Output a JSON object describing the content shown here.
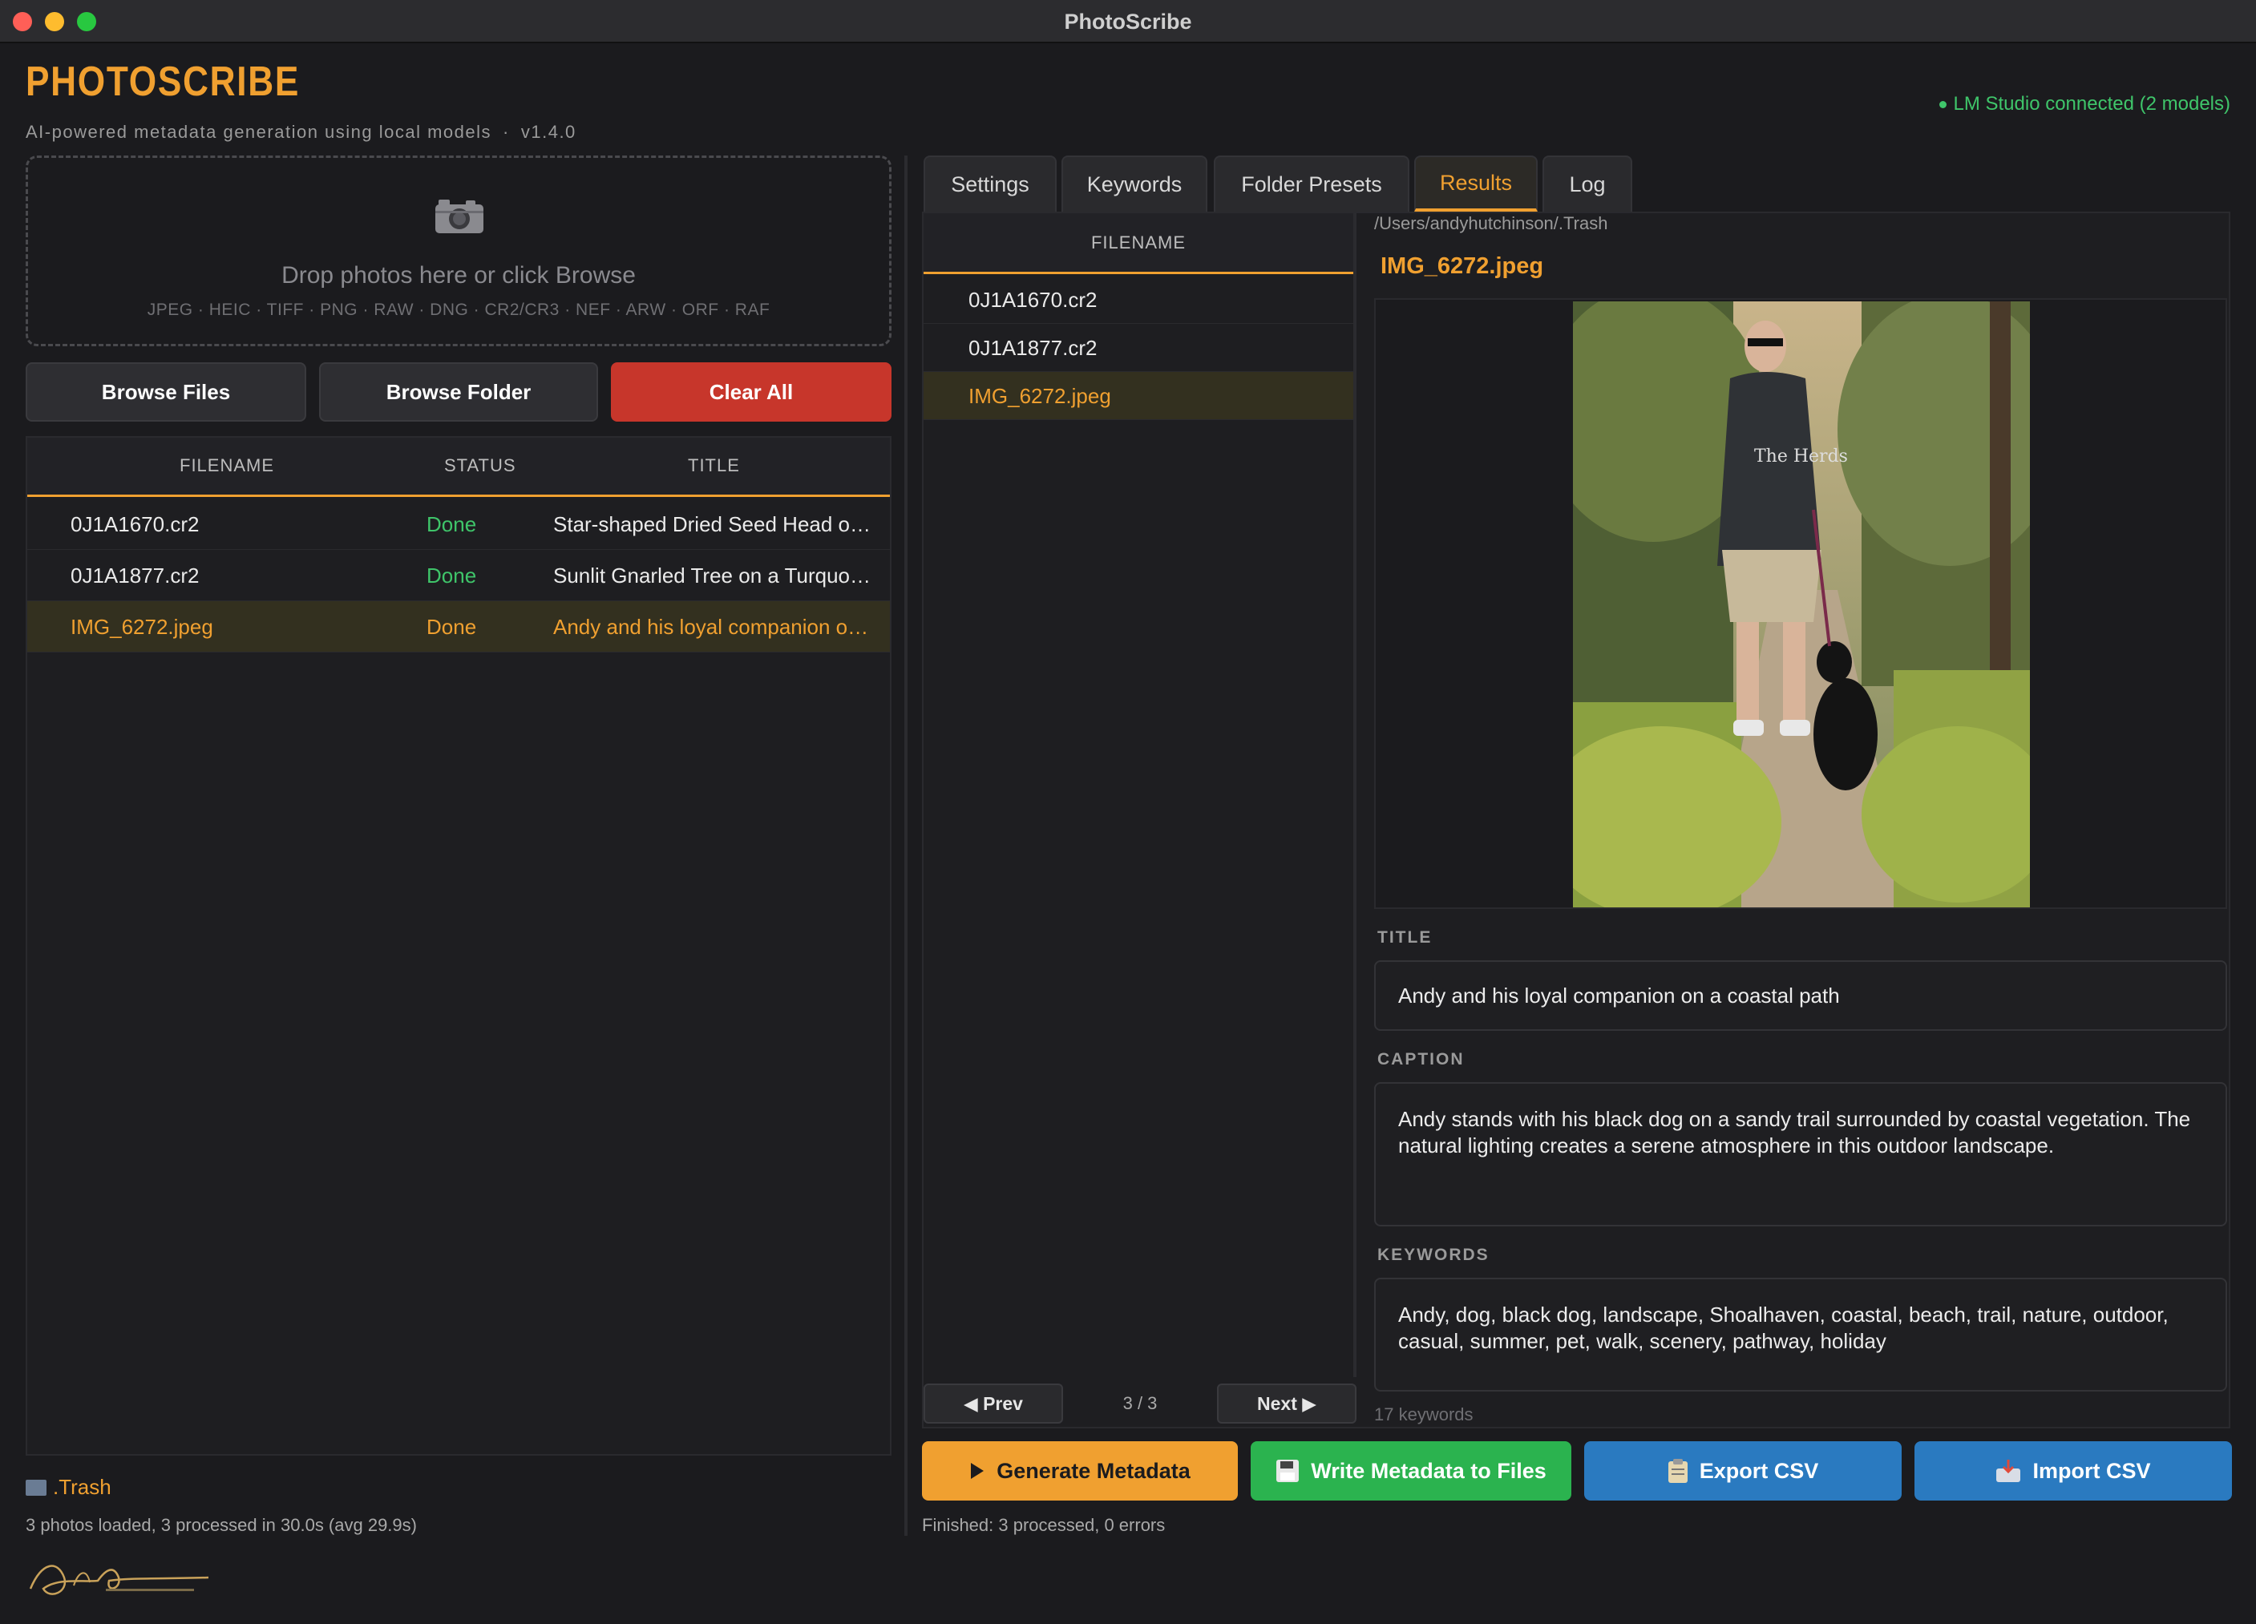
{
  "window": {
    "title": "PhotoScribe"
  },
  "app": {
    "brand": "PHOTOSCRIBE",
    "tagline": "AI-powered metadata generation using local models",
    "version": "v1.4.0",
    "lm_status": "LM Studio connected (2 models)"
  },
  "dropzone": {
    "text": "Drop photos here or click Browse",
    "formats": "JPEG · HEIC · TIFF · PNG · RAW · DNG · CR2/CR3 · NEF · ARW · ORF · RAF"
  },
  "buttons": {
    "browse_files": "Browse Files",
    "browse_folder": "Browse Folder",
    "clear_all": "Clear All"
  },
  "file_table": {
    "columns": [
      "FILENAME",
      "STATUS",
      "TITLE"
    ],
    "rows": [
      {
        "filename": "0J1A1670.cr2",
        "status": "Done",
        "title": "Star-shaped Dried Seed Head on a Turquoise Background"
      },
      {
        "filename": "0J1A1877.cr2",
        "status": "Done",
        "title": "Sunlit Gnarled Tree on a Turquoise Background"
      },
      {
        "filename": "IMG_6272.jpeg",
        "status": "Done",
        "title": "Andy and his loyal companion on a coastal path"
      }
    ]
  },
  "folder": {
    "name": ".Trash"
  },
  "left_status": "3 photos loaded, 3 processed in 30.0s (avg 29.9s)",
  "tabs": [
    "Settings",
    "Keywords",
    "Folder Presets",
    "Results",
    "Log"
  ],
  "results": {
    "list_header": "FILENAME",
    "files": [
      "0J1A1670.cr2",
      "0J1A1877.cr2",
      "IMG_6272.jpeg"
    ],
    "prev_label": "◀ Prev",
    "next_label": "Next ▶",
    "page": "3 / 3",
    "path": "/Users/andyhutchinson/.Trash",
    "selected_name": "IMG_6272.jpeg",
    "title_label": "TITLE",
    "title": "Andy and his loyal companion on a coastal path",
    "caption_label": "CAPTION",
    "caption": "Andy stands with his black dog on a sandy trail surrounded by coastal vegetation. The natural lighting creates a serene atmosphere in this outdoor landscape.",
    "keywords_label": "KEYWORDS",
    "keywords": "Andy, dog, black dog, landscape, Shoalhaven, coastal, beach, trail, nature, outdoor, casual, summer, pet, walk, scenery, pathway, holiday",
    "keyword_count": "17 keywords"
  },
  "actions": {
    "generate": "Generate Metadata",
    "write": "Write Metadata to Files",
    "export": "Export CSV",
    "import": "Import CSV"
  },
  "finished_status": "Finished: 3 processed, 0 errors",
  "colors": {
    "accent": "#f0a030",
    "done": "#3fc56a",
    "danger": "#c7362b",
    "write": "#2bb34f",
    "csv": "#2a7ac0"
  },
  "icons": [
    "camera-icon",
    "folder-icon",
    "play-icon",
    "save-icon",
    "clipboard-icon",
    "inbox-icon",
    "signature-logo"
  ]
}
